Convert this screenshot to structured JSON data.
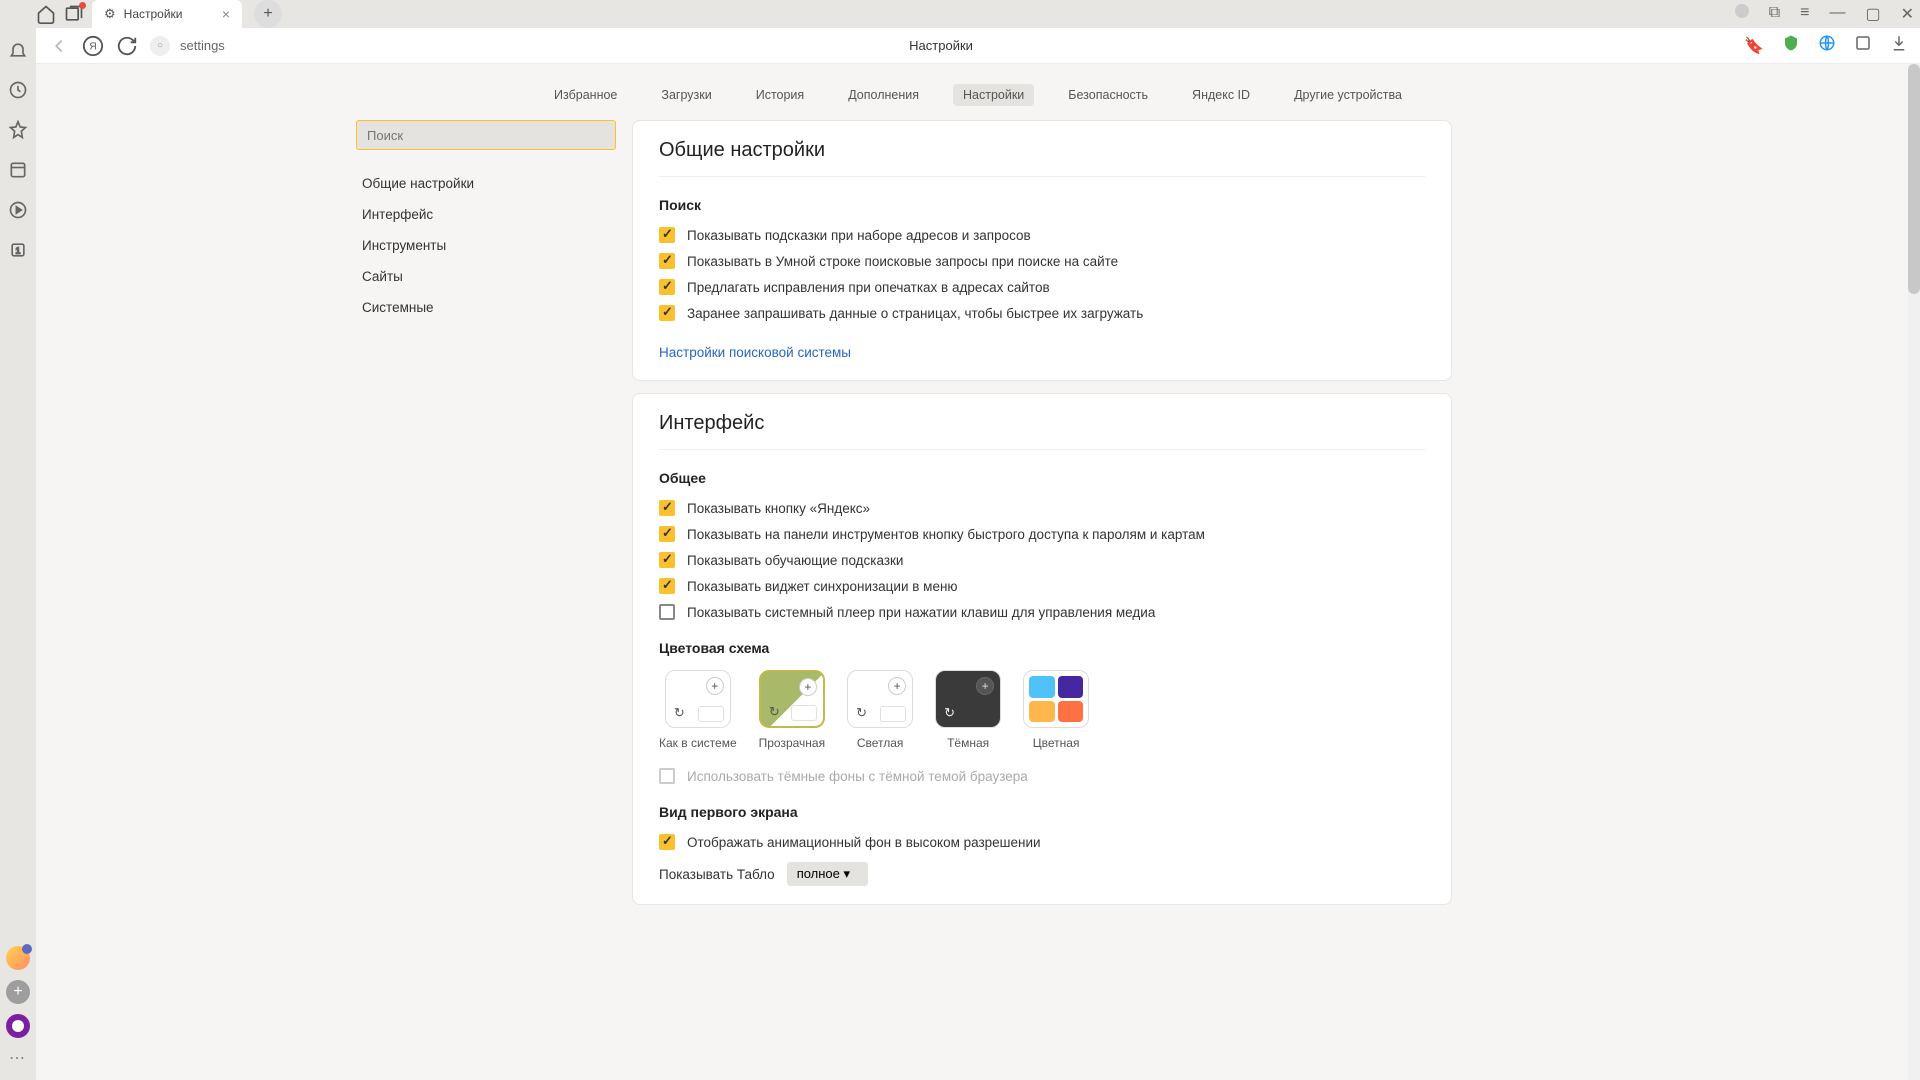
{
  "titlebar": {
    "tab_title": "Настройки"
  },
  "toolbar": {
    "address": "settings",
    "center": "Настройки"
  },
  "topnav": {
    "items": [
      "Избранное",
      "Загрузки",
      "История",
      "Дополнения",
      "Настройки",
      "Безопасность",
      "Яндекс ID",
      "Другие устройства"
    ],
    "active": 4
  },
  "sidebar_search": {
    "placeholder": "Поиск"
  },
  "leftnav": {
    "items": [
      "Общие настройки",
      "Интерфейс",
      "Инструменты",
      "Сайты",
      "Системные"
    ]
  },
  "sections": {
    "general": {
      "title": "Общие настройки",
      "search_title": "Поиск",
      "checks": [
        "Показывать подсказки при наборе адресов и запросов",
        "Показывать в Умной строке поисковые запросы при поиске на сайте",
        "Предлагать исправления при опечатках в адресах сайтов",
        "Заранее запрашивать данные о страницах, чтобы быстрее их загружать"
      ],
      "link": "Настройки поисковой системы"
    },
    "interface": {
      "title": "Интерфейс",
      "general_title": "Общее",
      "checks": [
        "Показывать кнопку «Яндекс»",
        "Показывать на панели инструментов кнопку быстрого доступа к паролям и картам",
        "Показывать обучающие подсказки",
        "Показывать виджет синхронизации в меню",
        "Показывать системный плеер при нажатии клавиш для управления медиа"
      ],
      "scheme_title": "Цветовая схема",
      "themes": [
        "Как в системе",
        "Прозрачная",
        "Светлая",
        "Тёмная",
        "Цветная"
      ],
      "dark_bg_check": "Использовать тёмные фоны с тёмной темой браузера",
      "first_screen_title": "Вид первого экрана",
      "first_screen_check": "Отображать анимационный фон в высоком разрешении",
      "tablo_label": "Показывать Табло",
      "tablo_value": "полное"
    }
  }
}
